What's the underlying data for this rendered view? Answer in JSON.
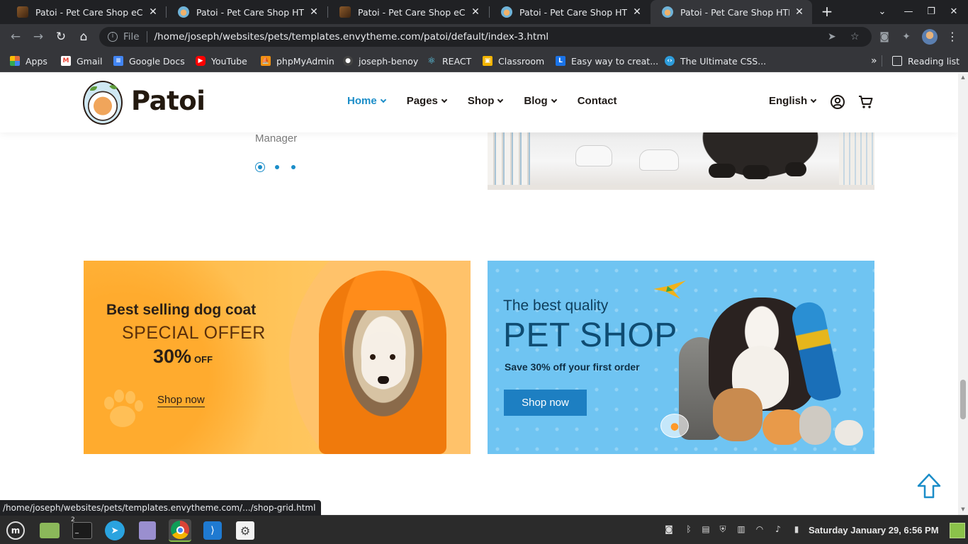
{
  "browser": {
    "tabs": [
      {
        "title": "Patoi - Pet Care Shop eCommerce",
        "favicon": "book-favicon",
        "active": false
      },
      {
        "title": "Patoi - Pet Care Shop HTML Template",
        "favicon": "dog-favicon",
        "active": false
      },
      {
        "title": "Patoi - Pet Care Shop eCommerce",
        "favicon": "book-favicon",
        "active": false
      },
      {
        "title": "Patoi - Pet Care Shop HTML Template",
        "favicon": "dog-favicon",
        "active": false
      },
      {
        "title": "Patoi - Pet Care Shop HTML Template",
        "favicon": "dog-favicon",
        "active": true
      }
    ],
    "address": {
      "scheme_label": "File",
      "url": "/home/joseph/websites/pets/templates.envytheme.com/patoi/default/index-3.html"
    },
    "bookmarks": [
      {
        "label": "Apps",
        "icon": "apps-grid-icon",
        "color": "#e06c3c"
      },
      {
        "label": "Gmail",
        "icon": "gmail-icon",
        "color": "#ea4335"
      },
      {
        "label": "Google Docs",
        "icon": "docs-icon",
        "color": "#4285f4"
      },
      {
        "label": "YouTube",
        "icon": "youtube-icon",
        "color": "#ff0000"
      },
      {
        "label": "phpMyAdmin",
        "icon": "phpmyadmin-icon",
        "color": "#f29111"
      },
      {
        "label": "joseph-benoy",
        "icon": "github-icon",
        "color": "#444444"
      },
      {
        "label": "REACT",
        "icon": "react-icon",
        "color": "#61dafb"
      },
      {
        "label": "Classroom",
        "icon": "classroom-icon",
        "color": "#f4b400"
      },
      {
        "label": "Easy way to creat...",
        "icon": "lc-icon",
        "color": "#1a73e8"
      },
      {
        "label": "The Ultimate CSS...",
        "icon": "code-icon",
        "color": "#2d9cdb"
      }
    ],
    "reading_list": "Reading list"
  },
  "site": {
    "brand": "Patoi",
    "nav": [
      {
        "label": "Home",
        "active": true,
        "dropdown": true
      },
      {
        "label": "Pages",
        "active": false,
        "dropdown": true
      },
      {
        "label": "Shop",
        "active": false,
        "dropdown": true
      },
      {
        "label": "Blog",
        "active": false,
        "dropdown": true
      },
      {
        "label": "Contact",
        "active": false,
        "dropdown": false
      }
    ],
    "language": "English",
    "accent_color": "#1b8dc8"
  },
  "testimonial": {
    "role": "Manager",
    "slide_count": 3,
    "active_slide": 1
  },
  "banners": {
    "left": {
      "line1": "Best selling dog coat",
      "line2": "SPECIAL OFFER",
      "percent": "30%",
      "off": "OFF",
      "cta": "Shop now"
    },
    "right": {
      "line1": "The best quality",
      "line2": "PET SHOP",
      "line3": "Save 30% off your first order",
      "cta": "Shop now"
    }
  },
  "status_bar": {
    "hover_url": "/home/joseph/websites/pets/templates.envytheme.com/.../shop-grid.html"
  },
  "taskbar": {
    "apps": [
      {
        "name": "mint-menu-icon"
      },
      {
        "name": "files-icon"
      },
      {
        "name": "terminal-icon",
        "badge": "2"
      },
      {
        "name": "telegram-icon"
      },
      {
        "name": "text-editor-icon"
      },
      {
        "name": "chrome-icon",
        "active": true
      },
      {
        "name": "vscode-icon"
      },
      {
        "name": "settings-icon"
      }
    ],
    "clock": "Saturday January 29, 6:56 PM"
  }
}
